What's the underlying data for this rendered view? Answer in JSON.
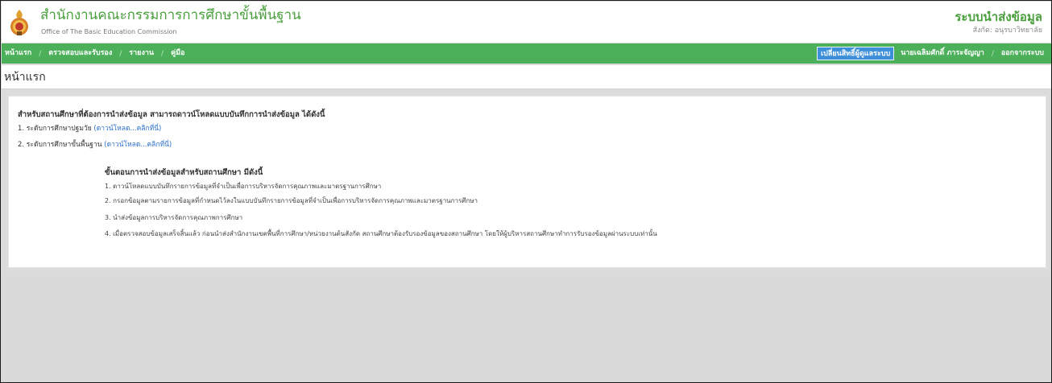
{
  "header": {
    "org_title": "สำนักงานคณะกรรมการการศึกษาขั้นพื้นฐาน",
    "org_subtitle": "Office of The Basic Education Commission",
    "system_title": "ระบบนำส่งข้อมูล",
    "system_subtitle": "สังกัด: อนุรบาวิทยาลัย"
  },
  "nav": {
    "left": [
      {
        "label": "หน้าแรก"
      },
      {
        "label": "ตรวจสอบและรับรอง"
      },
      {
        "label": "รายงาน"
      },
      {
        "label": "คู่มือ"
      }
    ],
    "switch_role_label": "เปลี่ยนสิทธิ์ผู้ดูแลระบบ",
    "user_name": "นายเฉลิมศักดิ์ ภาระจัญญา",
    "logout_label": "ออกจากระบบ"
  },
  "page": {
    "title": "หน้าแรก"
  },
  "content": {
    "intro": "สำหรับสถานศึกษาที่ต้องการนำส่งข้อมูล สามารถดาวน์โหลดแบบบันทึกการนำส่งข้อมูล ได้ดังนี้",
    "downloads": [
      {
        "label": "1. ระดับการศึกษาปฐมวัย",
        "link": "(ดาวน์โหลด...คลิกที่นี่)"
      },
      {
        "label": "2. ระดับการศึกษาขั้นพื้นฐาน",
        "link": "(ดาวน์โหลด...คลิกที่นี่)"
      }
    ],
    "steps_title": "ขั้นตอนการนำส่งข้อมูลสำหรับสถานศึกษา มีดังนี้",
    "steps": [
      "1. ดาวน์โหลดแบบบันทึกรายการข้อมูลที่จำเป็นเพื่อการบริหารจัดการคุณภาพและมาตรฐานการศึกษา",
      "2. กรอกข้อมูลตามรายการข้อมูลที่กำหนดไว้ลงในแบบบันทึกรายการข้อมูลที่จำเป็นเพื่อการบริหารจัดการคุณภาพและมาตรฐานการศึกษา",
      "3. นำส่งข้อมูลการบริหารจัดการคุณภาพการศึกษา",
      "4. เมื่อตรวจสอบข้อมูลเสร็จสิ้นแล้ว ก่อนนำส่งสำนักงานเขตพื้นที่การศึกษา/หน่วยงานต้นสังกัด สถานศึกษาต้องรับรองข้อมูลของสถานศึกษา โดยให้ผู้บริหารสถานศึกษาทำการรับรองข้อมูลผ่านระบบเท่านั้น"
    ]
  },
  "colors": {
    "brand_green": "#4cb05a",
    "title_green": "#4a9e3d",
    "active_blue": "#3d8fd8",
    "link_blue": "#2a6fc8"
  }
}
